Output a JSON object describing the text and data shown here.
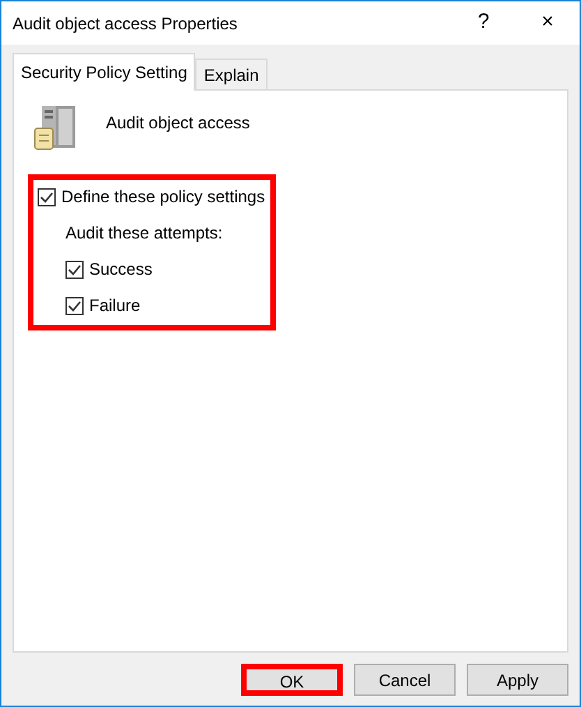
{
  "window": {
    "title": "Audit object access Properties",
    "help": "?",
    "close": "×"
  },
  "tabs": [
    {
      "label": "Security Policy Setting",
      "selected": true
    },
    {
      "label": "Explain",
      "selected": false
    }
  ],
  "policy": {
    "name": "Audit object access"
  },
  "settings": {
    "highlighted": true,
    "define": {
      "label": "Define these policy settings",
      "checked": true
    },
    "attempts_label": "Audit these attempts:",
    "attempts": [
      {
        "label": "Success",
        "checked": true
      },
      {
        "label": "Failure",
        "checked": true
      }
    ]
  },
  "buttons": [
    {
      "label": "OK",
      "highlighted": true
    },
    {
      "label": "Cancel",
      "highlighted": false
    },
    {
      "label": "Apply",
      "highlighted": false
    }
  ]
}
